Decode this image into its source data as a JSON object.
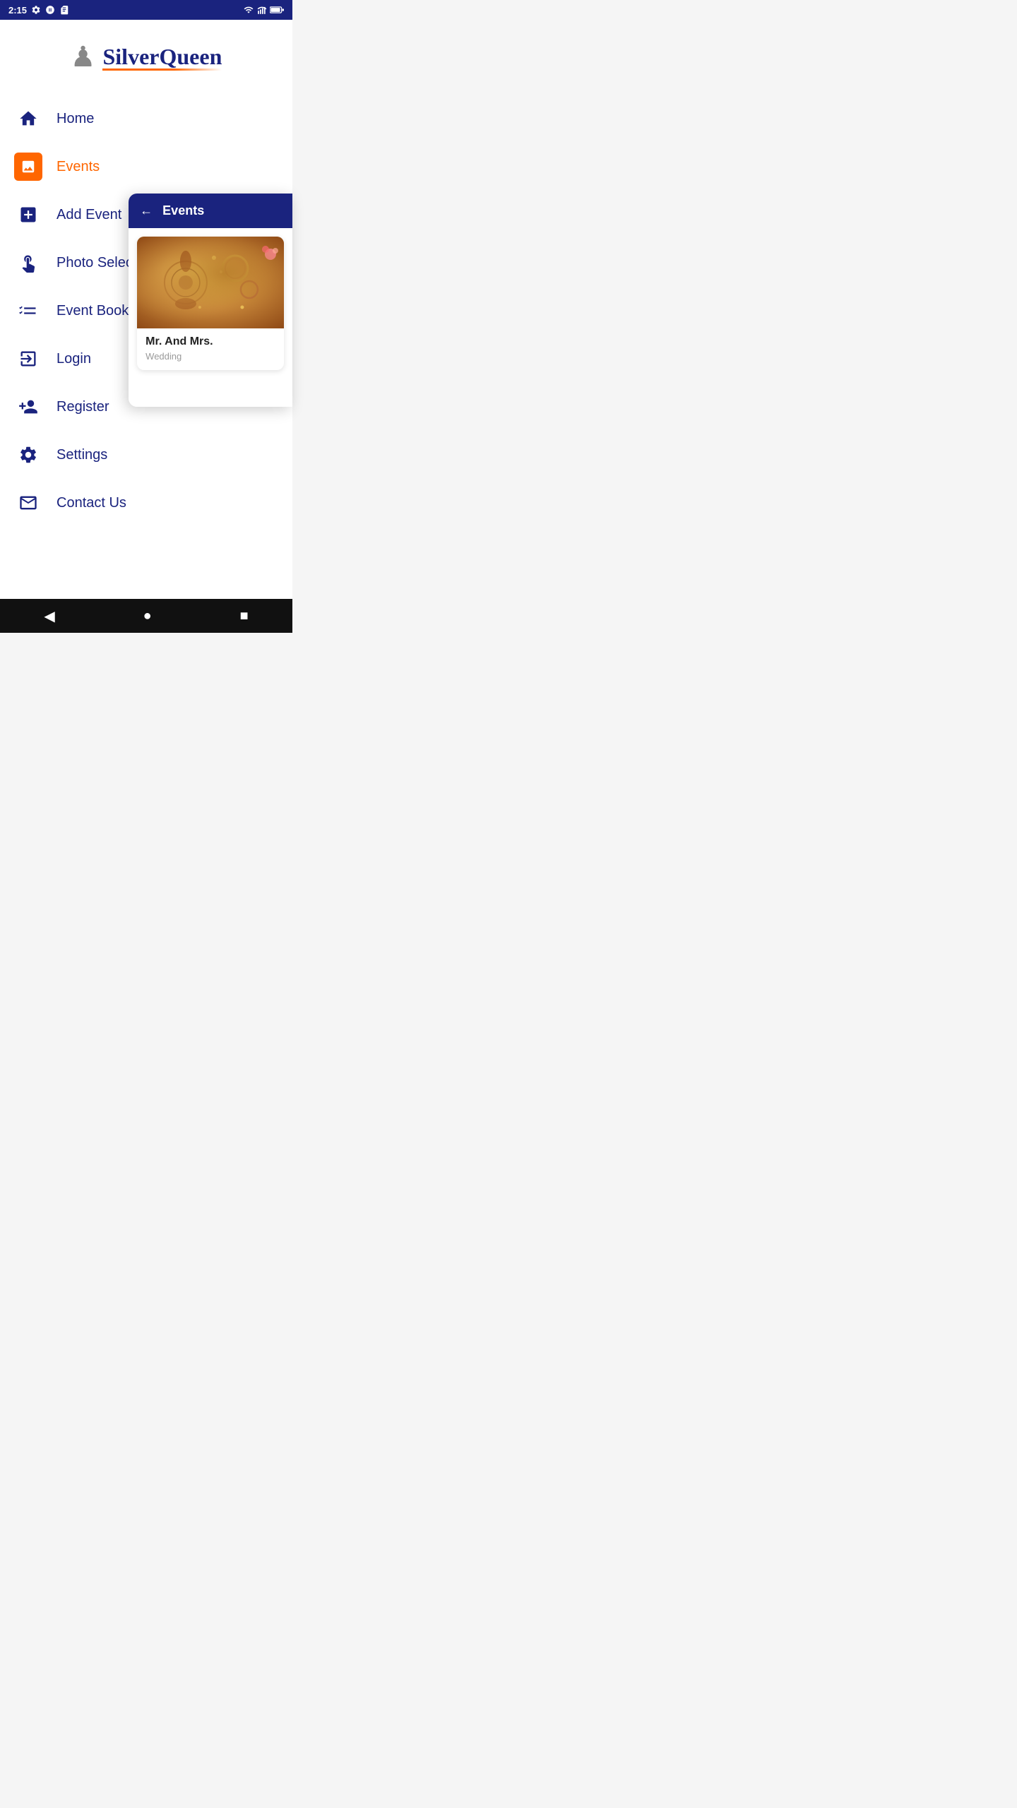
{
  "statusBar": {
    "time": "2:15",
    "icons": [
      "settings",
      "accessibility",
      "sim"
    ]
  },
  "logo": {
    "chessIcon": "♛",
    "brandName": "Silver",
    "brandNameAccent": " Queen",
    "altText": "Silver Queen Logo"
  },
  "menu": {
    "items": [
      {
        "id": "home",
        "label": "Home",
        "icon": "home",
        "active": false
      },
      {
        "id": "events",
        "label": "Events",
        "icon": "photo-orange",
        "active": true
      },
      {
        "id": "add-event",
        "label": "Add Event",
        "icon": "plus-square",
        "active": false
      },
      {
        "id": "photo-selection",
        "label": "Photo Selection",
        "icon": "touch",
        "active": false
      },
      {
        "id": "event-booking",
        "label": "Event Booking",
        "icon": "thumbs-up",
        "active": false
      },
      {
        "id": "login",
        "label": "Login",
        "icon": "login-arrow",
        "active": false
      },
      {
        "id": "register",
        "label": "Register",
        "icon": "add-person",
        "active": false
      },
      {
        "id": "settings",
        "label": "Settings",
        "icon": "gear",
        "active": false
      },
      {
        "id": "contact-us",
        "label": "Contact Us",
        "icon": "contact-card",
        "active": false
      }
    ]
  },
  "eventsPanel": {
    "title": "Events",
    "backLabel": "←",
    "card": {
      "name": "Mr. And Mrs.",
      "type": "Wedding",
      "imageAlt": "Wedding henna hands"
    }
  },
  "bottomNav": {
    "back": "◀",
    "home": "●",
    "recent": "■"
  }
}
